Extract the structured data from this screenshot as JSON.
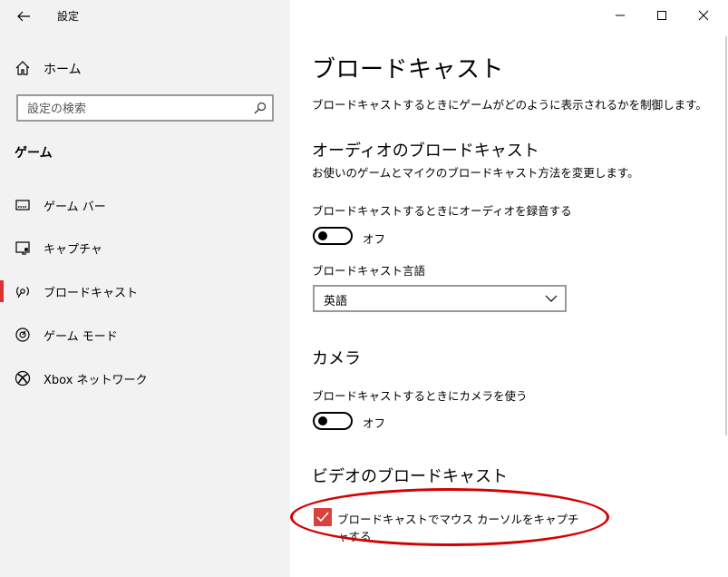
{
  "window": {
    "title": "設定"
  },
  "sidebar": {
    "home_label": "ホーム",
    "search_placeholder": "設定の検索",
    "section_title": "ゲーム",
    "items": [
      {
        "label": "ゲーム バー",
        "icon": "game-bar-icon",
        "selected": false
      },
      {
        "label": "キャプチャ",
        "icon": "capture-icon",
        "selected": false
      },
      {
        "label": "ブロードキャスト",
        "icon": "broadcast-icon",
        "selected": true
      },
      {
        "label": "ゲーム モード",
        "icon": "game-mode-icon",
        "selected": false
      },
      {
        "label": "Xbox ネットワーク",
        "icon": "xbox-icon",
        "selected": false
      }
    ]
  },
  "main": {
    "page_title": "ブロードキャスト",
    "description": "ブロードキャストするときにゲームがどのように表示されるかを制御します。",
    "audio": {
      "heading": "オーディオのブロードキャスト",
      "subtext": "お使いのゲームとマイクのブロードキャスト方法を変更します。",
      "record_label": "ブロードキャストするときにオーディオを録音する",
      "record_state": "オフ",
      "language_label": "ブロードキャスト言語",
      "language_value": "英語"
    },
    "camera": {
      "heading": "カメラ",
      "use_label": "ブロードキャストするときにカメラを使う",
      "use_state": "オフ"
    },
    "video": {
      "heading": "ビデオのブロードキャスト",
      "cursor_label": "ブロードキャストでマウス カーソルをキャプチャする",
      "cursor_checked": true
    }
  },
  "colors": {
    "accent": "#d9413d",
    "annotation": "#d40000",
    "sidebar_bg": "#f2f2f2"
  }
}
